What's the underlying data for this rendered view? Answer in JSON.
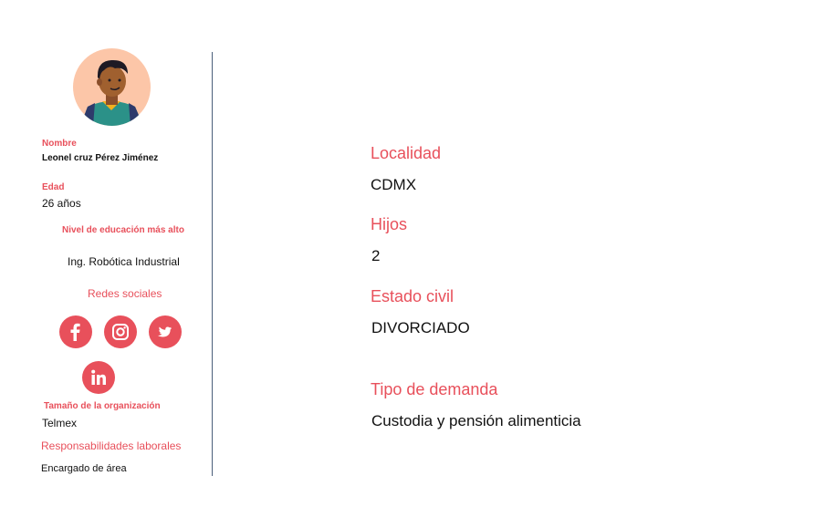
{
  "profile": {
    "name_label": "Nombre",
    "name": "Leonel cruz Pérez Jiménez",
    "age_label": "Edad",
    "age": "26 años",
    "education_label": "Nivel de educación más alto",
    "education": "Ing. Robótica Industrial",
    "social_label": "Redes sociales",
    "social_icons": [
      "facebook-icon",
      "instagram-icon",
      "twitter-icon",
      "linkedin-icon"
    ],
    "org_label": "Tamaño de la organización",
    "org": "Telmex",
    "resp_label": "Responsabilidades laborales",
    "resp": "Encargado de área"
  },
  "details": {
    "locality_label": "Localidad",
    "locality": "CDMX",
    "children_label": "Hijos",
    "children": "2",
    "civil_label": "Estado civil",
    "civil": "DIVORCIADO",
    "demand_label": "Tipo de demanda",
    "demand": "Custodia y pensión alimenticia"
  },
  "colors": {
    "accent": "#e8505b",
    "divider": "#4a5f7a",
    "avatar_bg": "#fcc6a8"
  }
}
